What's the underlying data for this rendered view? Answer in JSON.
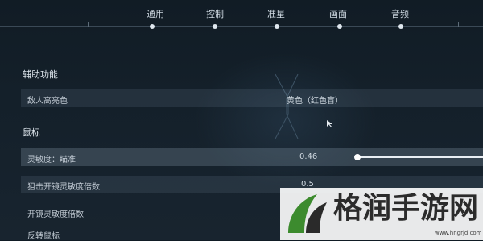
{
  "tabs": [
    {
      "label": "通用",
      "active": true
    },
    {
      "label": "控制",
      "active": false
    },
    {
      "label": "准星",
      "active": false
    },
    {
      "label": "画面",
      "active": false
    },
    {
      "label": "音频",
      "active": false
    }
  ],
  "accessibility": {
    "title": "辅助功能",
    "enemy_highlight": {
      "label": "敌人高亮色",
      "value": "黄色（红色盲）"
    }
  },
  "mouse": {
    "title": "鼠标",
    "sensitivity": {
      "label": "灵敏度：瞄准",
      "value": "0.46",
      "fill": 0.46
    },
    "scoped_multiplier": {
      "label": "狙击开镜灵敏度倍数",
      "value": "0.5"
    },
    "ads_multiplier": {
      "label": "开镜灵敏度倍数"
    },
    "invert": {
      "label": "反转鼠标"
    }
  },
  "watermark": {
    "text": "格润手游网",
    "url": "www.hngrjd.com"
  },
  "colors": {
    "background": "#14202a",
    "accent": "#e9eef3",
    "watermark_green": "#3c8b2e"
  }
}
